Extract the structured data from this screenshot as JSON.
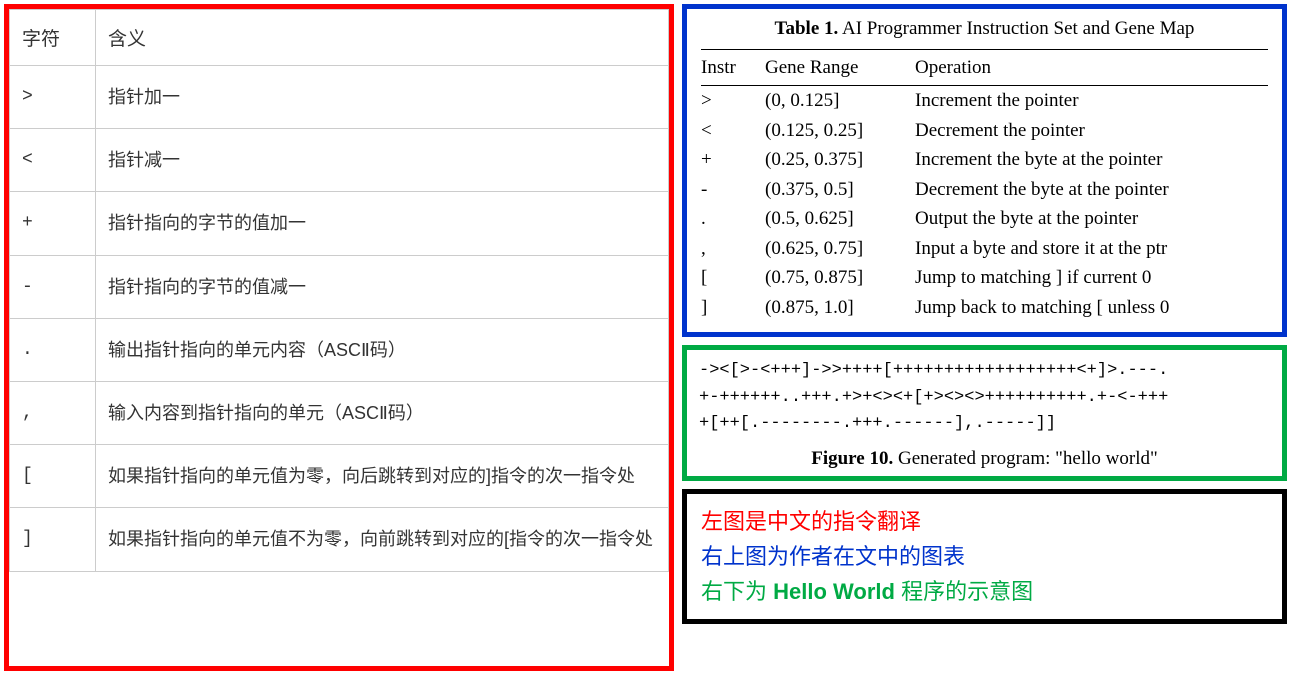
{
  "left_table": {
    "header_char": "字符",
    "header_meaning": "含义",
    "rows": [
      {
        "char": ">",
        "meaning": "指针加一"
      },
      {
        "char": "<",
        "meaning": "指针减一"
      },
      {
        "char": "+",
        "meaning": "指针指向的字节的值加一"
      },
      {
        "char": "-",
        "meaning": "指针指向的字节的值减一"
      },
      {
        "char": ".",
        "meaning": "输出指针指向的单元内容（ASCⅡ码）"
      },
      {
        "char": ",",
        "meaning": "输入内容到指针指向的单元（ASCⅡ码）"
      },
      {
        "char": "[",
        "meaning": "如果指针指向的单元值为零，向后跳转到对应的]指令的次一指令处"
      },
      {
        "char": "]",
        "meaning": "如果指针指向的单元值不为零，向前跳转到对应的[指令的次一指令处"
      }
    ]
  },
  "blue_table": {
    "caption_bold": "Table 1.",
    "caption_rest": "  AI Programmer Instruction Set and Gene Map",
    "header_instr": "Instr",
    "header_range": "Gene Range",
    "header_op": "Operation",
    "rows": [
      {
        "instr": ">",
        "range": "(0, 0.125]",
        "op": "Increment the pointer"
      },
      {
        "instr": "<",
        "range": "(0.125, 0.25]",
        "op": "Decrement the pointer"
      },
      {
        "instr": "+",
        "range": "(0.25, 0.375]",
        "op": "Increment the byte at the pointer"
      },
      {
        "instr": "-",
        "range": "(0.375, 0.5]",
        "op": "Decrement the byte at the pointer"
      },
      {
        "instr": ".",
        "range": "(0.5, 0.625]",
        "op": "Output the byte at the pointer"
      },
      {
        "instr": ",",
        "range": "(0.625, 0.75]",
        "op": "Input a byte and store it at the ptr"
      },
      {
        "instr": "[",
        "range": "(0.75, 0.875]",
        "op": "Jump to matching ] if current 0"
      },
      {
        "instr": "]",
        "range": "(0.875, 1.0]",
        "op": "Jump back to matching [ unless 0"
      }
    ]
  },
  "green_box": {
    "code_lines": [
      "-><[>-<+++]->>++++[++++++++++++++++++<+]>.---.",
      "+-++++++..+++.+>+<><+[+><><>++++++++++.+-<-+++",
      "+[++[.--------.+++.------],.-----]]"
    ],
    "fig_bold": "Figure 10.",
    "fig_rest": "  Generated program: \"hello world\""
  },
  "black_box": {
    "line1": "左图是中文的指令翻译",
    "line2": "右上图为作者在文中的图表",
    "line3_pre": "右下为 ",
    "line3_bold": "Hello World",
    "line3_post": " 程序的示意图"
  }
}
